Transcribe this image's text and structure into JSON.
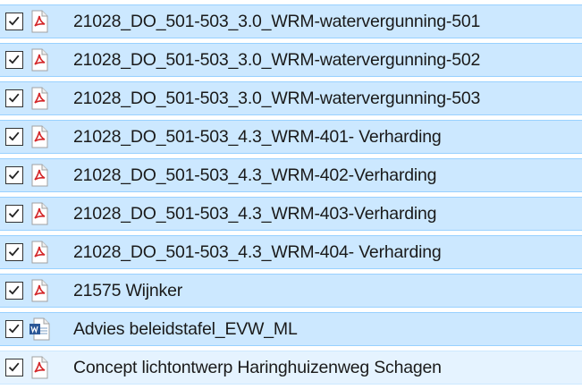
{
  "files": [
    {
      "name": "21028_DO_501-503_3.0_WRM-watervergunning-501",
      "type": "pdf",
      "icon": "pdf-file-icon",
      "checked": true
    },
    {
      "name": "21028_DO_501-503_3.0_WRM-watervergunning-502",
      "type": "pdf",
      "icon": "pdf-file-icon",
      "checked": true
    },
    {
      "name": "21028_DO_501-503_3.0_WRM-watervergunning-503",
      "type": "pdf",
      "icon": "pdf-file-icon",
      "checked": true
    },
    {
      "name": "21028_DO_501-503_4.3_WRM-401- Verharding",
      "type": "pdf",
      "icon": "pdf-file-icon",
      "checked": true
    },
    {
      "name": "21028_DO_501-503_4.3_WRM-402-Verharding",
      "type": "pdf",
      "icon": "pdf-file-icon",
      "checked": true
    },
    {
      "name": "21028_DO_501-503_4.3_WRM-403-Verharding",
      "type": "pdf",
      "icon": "pdf-file-icon",
      "checked": true
    },
    {
      "name": "21028_DO_501-503_4.3_WRM-404- Verharding",
      "type": "pdf",
      "icon": "pdf-file-icon",
      "checked": true
    },
    {
      "name": "21575 Wijnker",
      "type": "pdf",
      "icon": "pdf-file-icon",
      "checked": true
    },
    {
      "name": "Advies beleidstafel_EVW_ML",
      "type": "word",
      "icon": "word-document-icon",
      "checked": true
    },
    {
      "name": "Concept lichtontwerp Haringhuizenweg Schagen",
      "type": "pdf",
      "icon": "pdf-file-icon",
      "checked": true
    }
  ],
  "colors": {
    "selected_row": "#cce8ff",
    "selected_border": "#99d1ff",
    "hover_row": "#e5f3ff",
    "pdf_red": "#d4282a",
    "word_blue": "#2b5797"
  }
}
